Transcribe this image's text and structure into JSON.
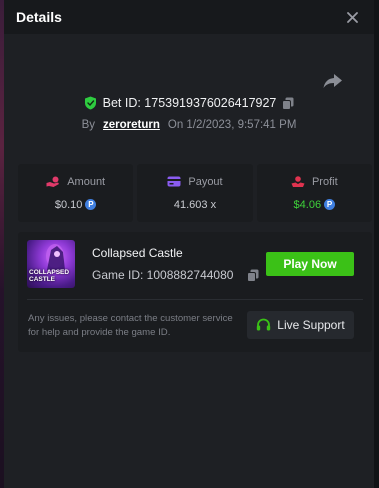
{
  "modal": {
    "title": "Details"
  },
  "bet": {
    "label": "Bet ID: 1753919376026417927",
    "by_label": "By",
    "username": "zeroreturn",
    "on_label": "On 1/2/2023, 9:57:41 PM"
  },
  "stats": {
    "amount": {
      "label": "Amount",
      "value": "$0.10",
      "icon": "hand-coin-icon"
    },
    "payout": {
      "label": "Payout",
      "value": "41.603 x",
      "icon": "wallet-card-icon"
    },
    "profit": {
      "label": "Profit",
      "value": "$4.06",
      "icon": "profit-hand-icon"
    }
  },
  "currency_symbol": "P",
  "game": {
    "thumb_text_1": "COLLAPSED",
    "thumb_text_2": "CASTLE",
    "name": "Collapsed Castle",
    "id_label": "Game ID: 1008882744080",
    "play_label": "Play Now",
    "notice": "Any issues, please contact the customer service for help and provide the game ID.",
    "support_label": "Live Support"
  },
  "colors": {
    "accent_green": "#3bc117",
    "profit_green": "#3ed13a",
    "coin_blue": "#3f7fe0",
    "shield_green": "#2ecc40",
    "amount_pink": "#e03a6a",
    "payout_purple": "#8a5cf0",
    "profit_red": "#e0334f"
  }
}
